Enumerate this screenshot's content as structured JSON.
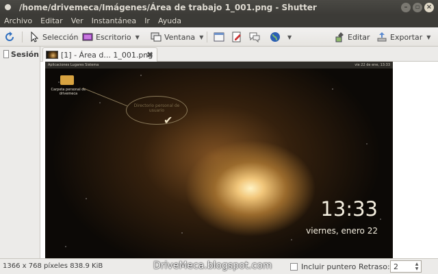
{
  "window": {
    "title": "/home/drivemeca/Imágenes/Área de trabajo 1_001.png - Shutter"
  },
  "menu": [
    "Archivo",
    "Editar",
    "Ver",
    "Instantánea",
    "Ir",
    "Ayuda"
  ],
  "toolbar": {
    "selection_label": "Selección",
    "desktop_label": "Escritorio",
    "window_label": "Ventana",
    "edit_label": "Editar",
    "export_label": "Exportar"
  },
  "sidebar": {
    "session_label": "Sesión"
  },
  "tabs": [
    {
      "label": "[1] - Área d... 1_001.png"
    }
  ],
  "screenshot": {
    "panel_left": "Aplicaciones   Lugares   Sistema",
    "panel_right": "vie 22 de ene, 13:33",
    "folder_label": "Carpeta personal de drivemeca",
    "callout_text": "Directorio personal de usuario",
    "clock": "13:33",
    "date": "viernes, enero 22"
  },
  "status": {
    "info": "1366 x 768 píxeles  838.9 KiB",
    "watermark": "DriveMeca.blogspot.com",
    "pointer_label": "Incluir puntero",
    "delay_label": "Retraso:",
    "delay_value": "2"
  },
  "colors": {
    "titlebar": "#3c3b37",
    "menu_text": "#dfdbd2",
    "toolbar_bg": "#f2f1f0"
  }
}
